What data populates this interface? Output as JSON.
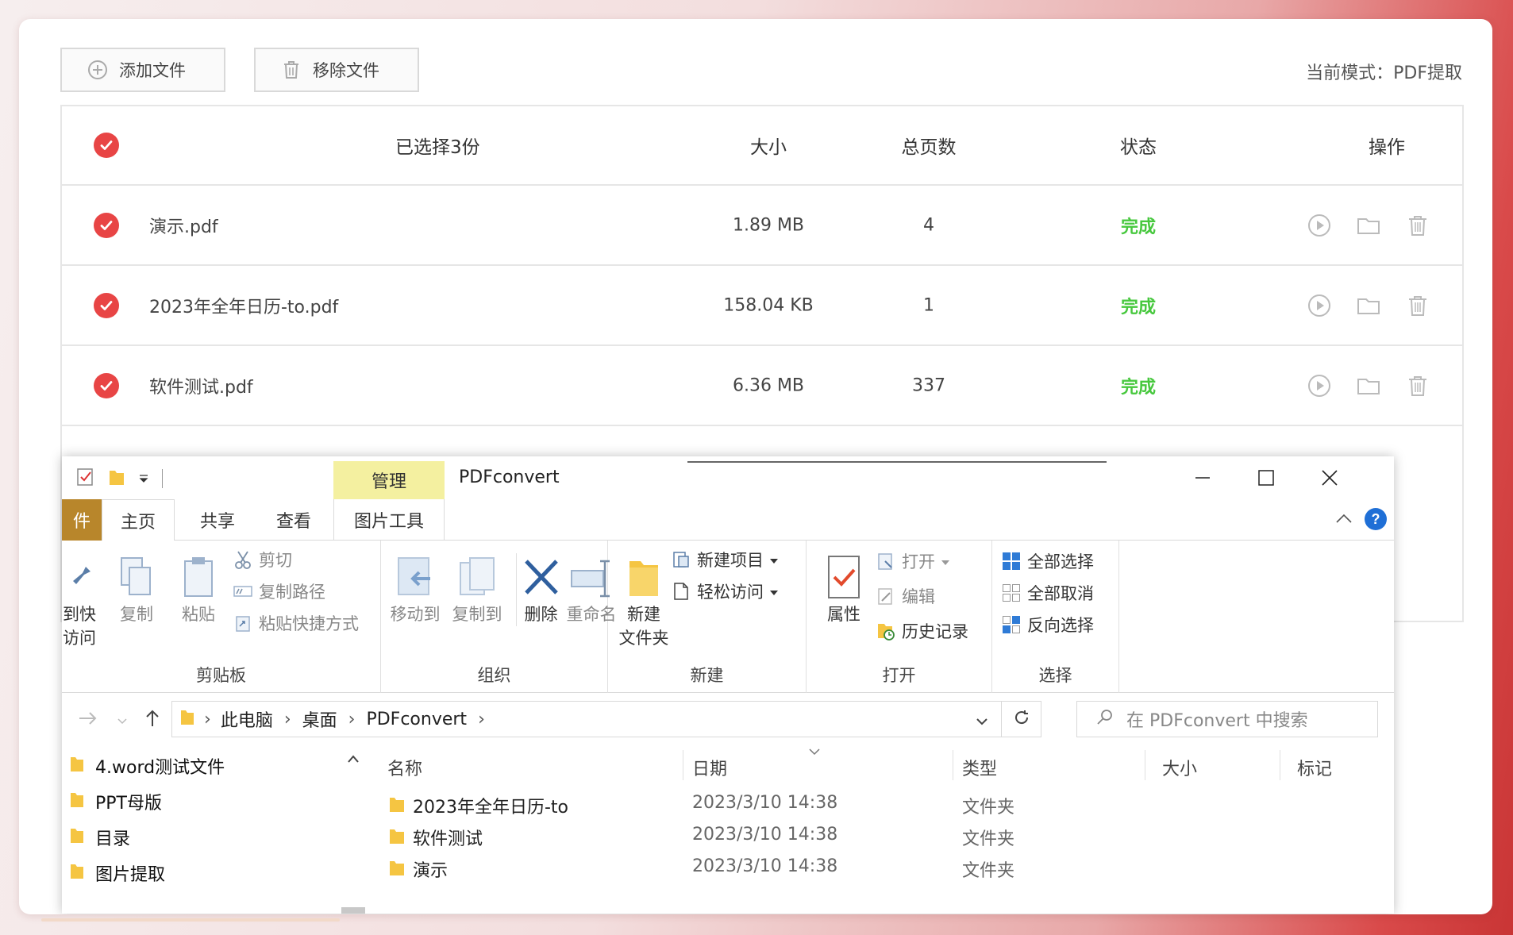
{
  "toolbar": {
    "add_label": "添加文件",
    "remove_label": "移除文件",
    "mode_text": "当前模式：PDF提取"
  },
  "table": {
    "header": {
      "selected": "已选择3份",
      "size": "大小",
      "pages": "总页数",
      "status": "状态",
      "ops": "操作"
    },
    "rows": [
      {
        "name": "演示.pdf",
        "size": "1.89 MB",
        "pages": "4",
        "status": "完成"
      },
      {
        "name": "2023年全年日历-to.pdf",
        "size": "158.04 KB",
        "pages": "1",
        "status": "完成"
      },
      {
        "name": "软件测试.pdf",
        "size": "6.36 MB",
        "pages": "337",
        "status": "完成"
      }
    ]
  },
  "explorer": {
    "manage_tab": "管理",
    "title": "PDFconvert",
    "tabs": {
      "file": "件",
      "home": "主页",
      "share": "共享",
      "view": "查看",
      "picture_tools": "图片工具"
    },
    "ribbon": {
      "clipboard": {
        "pin_line1": "到快",
        "pin_line2": "访问",
        "copy": "复制",
        "paste": "粘贴",
        "cut": "剪切",
        "copy_path": "复制路径",
        "paste_shortcut": "粘贴快捷方式",
        "label": "剪贴板"
      },
      "organize": {
        "move_to": "移动到",
        "copy_to": "复制到",
        "delete": "删除",
        "rename": "重命名",
        "label": "组织"
      },
      "new": {
        "new_item": "新建项目",
        "easy_access": "轻松访问",
        "new_folder_line1": "新建",
        "new_folder_line2": "文件夹",
        "label": "新建"
      },
      "open": {
        "properties": "属性",
        "open": "打开",
        "edit": "编辑",
        "history": "历史记录",
        "label": "打开"
      },
      "select": {
        "select_all": "全部选择",
        "select_none": "全部取消",
        "invert": "反向选择",
        "label": "选择"
      }
    },
    "address": {
      "crumbs": [
        "此电脑",
        "桌面",
        "PDFconvert"
      ],
      "search_placeholder": "在 PDFconvert 中搜索"
    },
    "nav_tree": [
      "4.word测试文件",
      "PPT母版",
      "目录",
      "图片提取"
    ],
    "columns": {
      "name": "名称",
      "date": "日期",
      "type": "类型",
      "size": "大小",
      "tag": "标记"
    },
    "files": [
      {
        "name": "2023年全年日历-to",
        "date": "2023/3/10 14:38",
        "type": "文件夹"
      },
      {
        "name": "软件测试",
        "date": "2023/3/10 14:38",
        "type": "文件夹"
      },
      {
        "name": "演示",
        "date": "2023/3/10 14:38",
        "type": "文件夹"
      }
    ]
  },
  "colors": {
    "accent_red": "#e84545",
    "status_green": "#47c83e",
    "manage_tab": "#f4f0a0",
    "file_tab": "#b8862b"
  }
}
